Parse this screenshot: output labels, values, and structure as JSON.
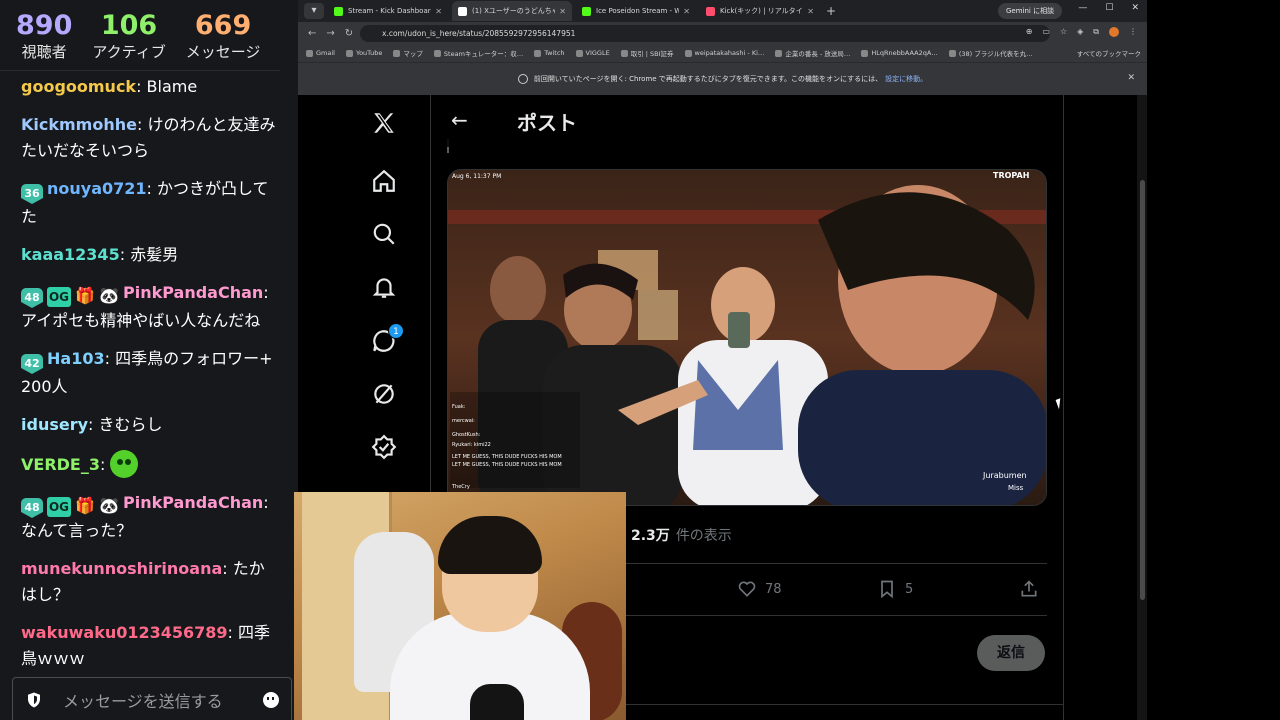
{
  "stream_stats": {
    "viewers": {
      "value": "890",
      "label": "視聴者"
    },
    "active": {
      "value": "106",
      "label": "アクティブ"
    },
    "messages": {
      "value": "669",
      "label": "メッセージ"
    }
  },
  "chat": {
    "messages": [
      {
        "user": "googoomuck",
        "color": "#f5c94a",
        "text": "Blame"
      },
      {
        "user": "Kickmmohhe",
        "color": "#9fc8ff",
        "text": "けのわんと友達みたいだなそいつら"
      },
      {
        "user": "nouya0721",
        "color": "#6fb6ff",
        "badge": "36",
        "text": "かつきが凸してた"
      },
      {
        "user": "kaaa12345",
        "color": "#5ce0d0",
        "text": "赤髪男"
      },
      {
        "user": "PinkPandaChan",
        "color": "#ff9ad0",
        "badge": "48",
        "extra_badges": [
          "OG",
          "gift",
          "cat"
        ],
        "text": "アイポセも精神やばい人なんだね"
      },
      {
        "user": "Ha103",
        "color": "#7fd0ff",
        "badge": "42",
        "text": "四季鳥のフォロワー+200人"
      },
      {
        "user": "idusery",
        "color": "#9fe6ff",
        "text": "きむらし"
      },
      {
        "user": "VERDE_3",
        "color": "#8ff06a",
        "text": "",
        "emote": "green-face-emote"
      },
      {
        "user": "PinkPandaChan",
        "color": "#ff9ad0",
        "badge": "48",
        "extra_badges": [
          "OG",
          "gift",
          "cat"
        ],
        "text": "なんて言った？"
      },
      {
        "user": "munekunnoshirinoana",
        "color": "#ff7aa8",
        "text": "たかはし？"
      },
      {
        "user": "wakuwaku0123456789",
        "color": "#ff6a8a",
        "text": "四季鳥ｗｗｗ"
      }
    ],
    "input_placeholder": "メッセージを送信する"
  },
  "browser": {
    "tabs": [
      {
        "title": "Stream - Kick Dashboard",
        "color": "#53fc18",
        "active": false
      },
      {
        "title": "(1) Xユーザーのうどんちゃんねる",
        "color": "#ffffff",
        "active": true
      },
      {
        "title": "Ice Poseidon Stream - Watch Li",
        "color": "#53fc18",
        "active": false
      },
      {
        "title": "Kick(キック) | リアルタイムランキング",
        "color": "#ff4d6d",
        "active": false
      }
    ],
    "new_tab": "+",
    "gemini_label": "Gemini に相談",
    "window_buttons": [
      "—",
      "☐",
      "✕"
    ],
    "url": "x.com/udon_is_here/status/2085592972956147951",
    "bookmarks": [
      "Gmail",
      "YouTube",
      "マップ",
      "Steamキュレーター：収…",
      "Twitch",
      "VIGGLE",
      "取引 | SBI証券",
      "weipatakahashi - Ki…",
      "企業の番長 - 放送局…",
      "HLqRnebbAAA2qA…",
      "(38) ブラジル代表を丸…"
    ],
    "bookmarks_all": "すべてのブックマーク",
    "infobar_text": "前回開いていたページを開く: Chrome で再起動するたびにタブを復元できます。この機能をオンにするには、",
    "infobar_link": "設定に移動。"
  },
  "x_post": {
    "header_title": "ポスト",
    "notification_count": "1",
    "views_value": "2.3万",
    "views_label": "件の表示",
    "likes": "78",
    "bookmarks": "5",
    "reply_button": "返信",
    "media": {
      "timestamp": "Aug 6, 11:37 PM",
      "brand": "TROPAH",
      "caption_name": "Jurabumen",
      "caption_sub": "Miss",
      "overlay_chat": [
        "Fuak:",
        "mercwai:",
        "GhostKush:",
        "Ryukari: kimi22",
        "LET ME GUESS, THIS DUDE FUCKS HIS MOM",
        "LET ME GUESS, THIS DUDE FUCKS HIS MOM",
        "TheCry"
      ]
    }
  },
  "colors": {
    "kick_green": "#53fc18",
    "x_blue": "#1d9bf0",
    "chat_bg": "#17181b"
  }
}
